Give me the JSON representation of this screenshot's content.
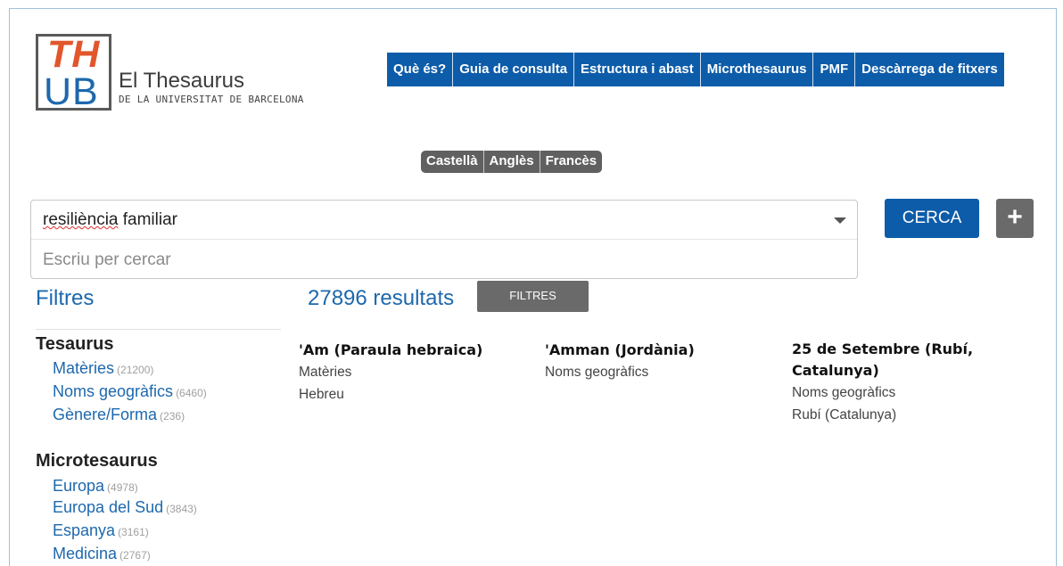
{
  "logo": {
    "th": "TH",
    "ub": "UB",
    "title": "El Thesaurus",
    "subtitle": "DE LA UNIVERSITAT DE BARCELONA"
  },
  "nav": {
    "items": [
      "Què és?",
      "Guia de consulta",
      "Estructura i abast",
      "Microthesaurus",
      "PMF",
      "Descàrrega de fitxers"
    ]
  },
  "languages": [
    "Castellà",
    "Anglès",
    "Francès"
  ],
  "search": {
    "value_word1": "resiliència",
    "value_word2": " familiar",
    "placeholder": "Escriu per cercar",
    "button": "CERCA",
    "plus": "+"
  },
  "sidebar": {
    "title": "Filtres",
    "groups": [
      {
        "title": "Tesaurus",
        "items": [
          {
            "label": "Matèries",
            "count": "(21200)"
          },
          {
            "label": "Noms geogràfics",
            "count": "(6460)"
          },
          {
            "label": "Gènere/Forma",
            "count": "(236)"
          }
        ]
      },
      {
        "title": "Microtesaurus",
        "items": [
          {
            "label": "Europa",
            "count": "(4978)"
          },
          {
            "label": "Europa del Sud",
            "count": "(3843)"
          },
          {
            "label": "Espanya",
            "count": "(3161)"
          },
          {
            "label": "Medicina",
            "count": "(2767)"
          }
        ]
      }
    ]
  },
  "results": {
    "count": "27896 resultats",
    "filters_button": "FILTRES",
    "items": [
      {
        "title": "'Am (Paraula hebraica)",
        "line1": "Matèries",
        "line2": "Hebreu"
      },
      {
        "title": "'Amman (Jordània)",
        "line1": "Noms geogràfics",
        "line2": ""
      },
      {
        "title": "25 de Setembre (Rubí, Catalunya)",
        "line1": "Noms geogràfics",
        "line2": "Rubí (Catalunya)"
      }
    ]
  },
  "colors": {
    "brand_blue": "#0d5ca9",
    "link_blue": "#1d68ad",
    "logo_orange": "#e2562c",
    "grey_button": "#6a6a6a"
  }
}
